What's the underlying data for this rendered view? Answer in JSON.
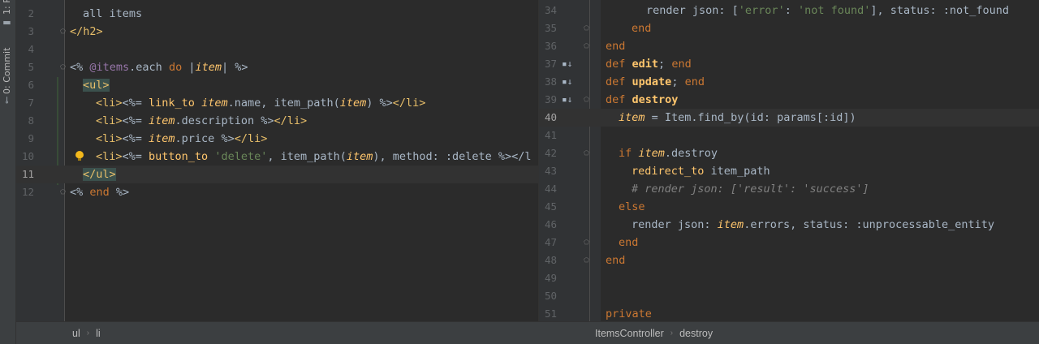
{
  "sidebar": {
    "project_tab": "1: P",
    "commit_tab": "0: Commit"
  },
  "left_editor": {
    "lines": [
      {
        "num": "2",
        "code": "all items"
      },
      {
        "num": "3",
        "code": "</h2>"
      },
      {
        "num": "4",
        "code": ""
      },
      {
        "num": "5",
        "code": "<% @items.each do |item| %>"
      },
      {
        "num": "6",
        "code": "<ul>"
      },
      {
        "num": "7",
        "code": "<li><%= link_to item.name, item_path(item) %></li>"
      },
      {
        "num": "8",
        "code": "<li><%= item.description %></li>"
      },
      {
        "num": "9",
        "code": "<li><%= item.price %></li>"
      },
      {
        "num": "10",
        "code": "<li><%= button_to 'delete', item_path(item), method: :delete %></l"
      },
      {
        "num": "11",
        "code": "</ul>"
      },
      {
        "num": "12",
        "code": "<% end %>"
      }
    ],
    "breadcrumb": [
      "ul",
      "li"
    ]
  },
  "right_editor": {
    "lines": [
      {
        "num": "34",
        "code": "render json: ['error': 'not found'], status: :not_found"
      },
      {
        "num": "35",
        "code": "end"
      },
      {
        "num": "36",
        "code": "end"
      },
      {
        "num": "37",
        "code": "def edit; end"
      },
      {
        "num": "38",
        "code": "def update; end"
      },
      {
        "num": "39",
        "code": "def destroy"
      },
      {
        "num": "40",
        "code": "item = Item.find_by(id: params[:id])"
      },
      {
        "num": "41",
        "code": ""
      },
      {
        "num": "42",
        "code": "if item.destroy"
      },
      {
        "num": "43",
        "code": "redirect_to item_path"
      },
      {
        "num": "44",
        "code": "# render json: ['result': 'success']"
      },
      {
        "num": "45",
        "code": "else"
      },
      {
        "num": "46",
        "code": "render json: item.errors, status: :unprocessable_entity"
      },
      {
        "num": "47",
        "code": "end"
      },
      {
        "num": "48",
        "code": "end"
      },
      {
        "num": "49",
        "code": ""
      },
      {
        "num": "50",
        "code": ""
      },
      {
        "num": "51",
        "code": "private"
      }
    ],
    "breadcrumb": [
      "ItemsController",
      "destroy"
    ]
  },
  "icons": {
    "fold_marker": "fold-marker-icon",
    "override_marker": "override-method-icon",
    "intention": "lightbulb-icon"
  },
  "colors": {
    "background": "#2b2b2b",
    "keyword": "#cc7832",
    "string": "#6a8759",
    "method": "#ffc66d",
    "instance_var": "#9876aa",
    "comment": "#808080",
    "tag": "#e8bf6a"
  }
}
